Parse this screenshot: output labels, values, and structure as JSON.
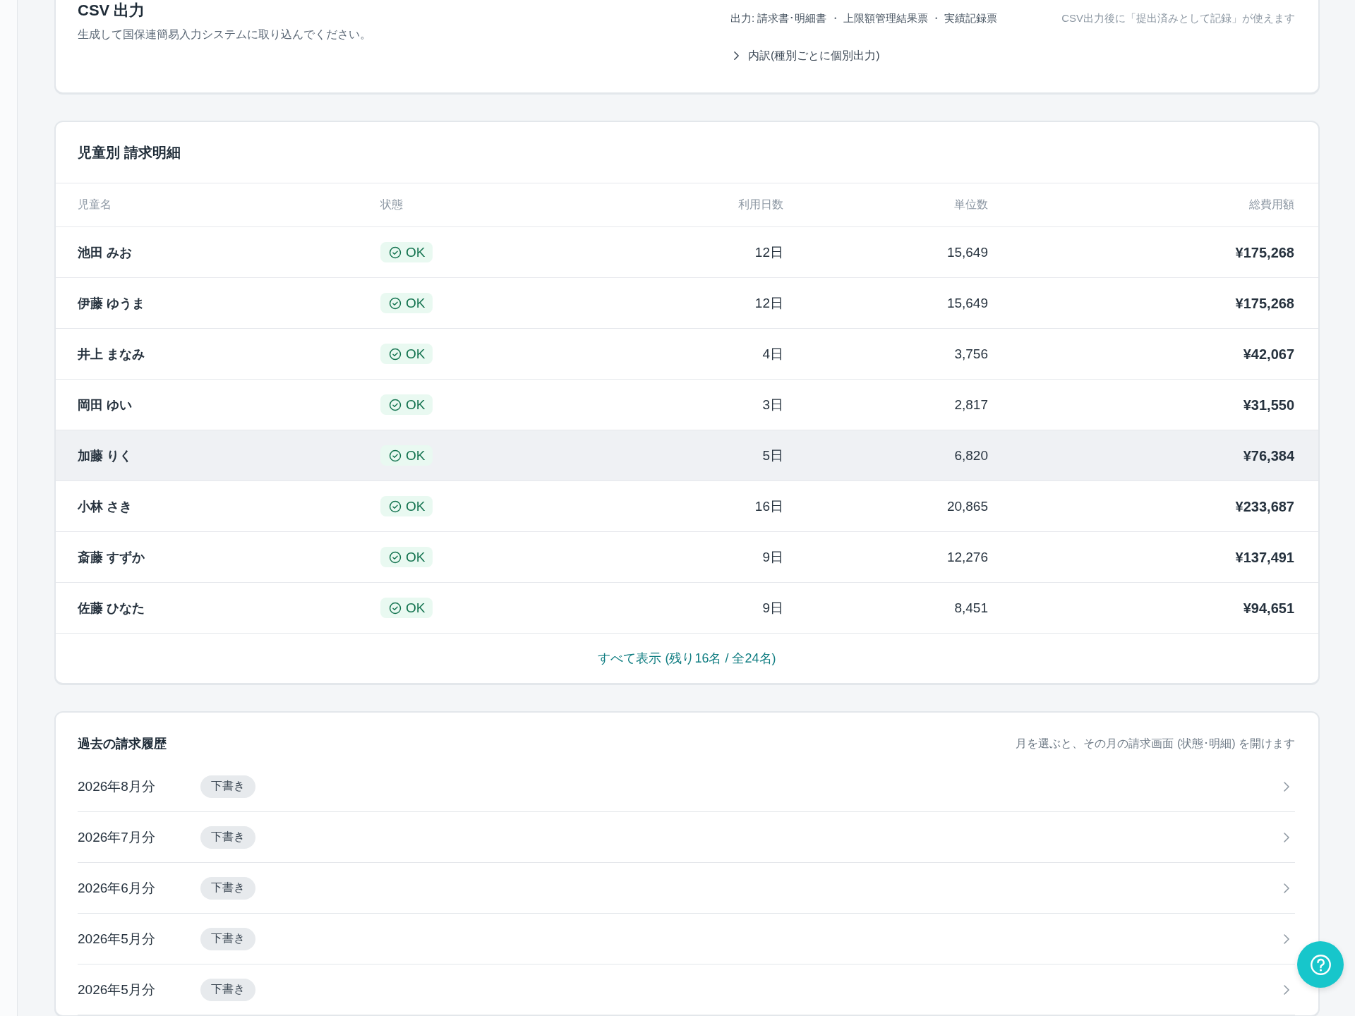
{
  "csv_export": {
    "title": "CSV 出力",
    "description": "生成して国保連簡易入力システムに取り込んでください。",
    "outputs": "出力: 請求書･明細書 ・ 上限額管理結果票 ・ 実績記録票",
    "note": "CSV出力後に「提出済みとして記録」が使えます",
    "breakdown": {
      "label": "内訳(種別ごとに個別出力)",
      "expanded": false
    }
  },
  "billing_details": {
    "title": "児童別 請求明細",
    "columns": [
      "児童名",
      "状態",
      "利用日数",
      "単位数",
      "総費用額"
    ],
    "rows": [
      {
        "name": "池田 みお",
        "status": {
          "kind": "ok",
          "label": "OK"
        },
        "days": "12日",
        "units": "15,649",
        "total": "¥175,268",
        "hovered": false
      },
      {
        "name": "伊藤 ゆうま",
        "status": {
          "kind": "ok",
          "label": "OK"
        },
        "days": "12日",
        "units": "15,649",
        "total": "¥175,268",
        "hovered": false
      },
      {
        "name": "井上 まなみ",
        "status": {
          "kind": "ok",
          "label": "OK"
        },
        "days": "4日",
        "units": "3,756",
        "total": "¥42,067",
        "hovered": false
      },
      {
        "name": "岡田 ゆい",
        "status": {
          "kind": "ok",
          "label": "OK"
        },
        "days": "3日",
        "units": "2,817",
        "total": "¥31,550",
        "hovered": false
      },
      {
        "name": "加藤 りく",
        "status": {
          "kind": "ok",
          "label": "OK"
        },
        "days": "5日",
        "units": "6,820",
        "total": "¥76,384",
        "hovered": true
      },
      {
        "name": "小林 さき",
        "status": {
          "kind": "ok",
          "label": "OK"
        },
        "days": "16日",
        "units": "20,865",
        "total": "¥233,687",
        "hovered": false
      },
      {
        "name": "斎藤 すずか",
        "status": {
          "kind": "ok",
          "label": "OK"
        },
        "days": "9日",
        "units": "12,276",
        "total": "¥137,491",
        "hovered": false
      },
      {
        "name": "佐藤 ひなた",
        "status": {
          "kind": "ok",
          "label": "OK"
        },
        "days": "9日",
        "units": "8,451",
        "total": "¥94,651",
        "hovered": false
      }
    ],
    "show_all": "すべて表示 (残り16名 / 全24名)"
  },
  "billing_history": {
    "title": "過去の請求履歴",
    "hint": "月を選ぶと、その月の請求画面 (状態･明細) を開けます",
    "items": [
      {
        "month": "2026年8月分",
        "status": {
          "kind": "draft",
          "label": "下書き"
        }
      },
      {
        "month": "2026年7月分",
        "status": {
          "kind": "draft",
          "label": "下書き"
        }
      },
      {
        "month": "2026年6月分",
        "status": {
          "kind": "draft",
          "label": "下書き"
        }
      },
      {
        "month": "2026年5月分",
        "status": {
          "kind": "draft",
          "label": "下書き"
        }
      },
      {
        "month": "2026年5月分",
        "status": {
          "kind": "draft",
          "label": "下書き"
        }
      }
    ]
  }
}
